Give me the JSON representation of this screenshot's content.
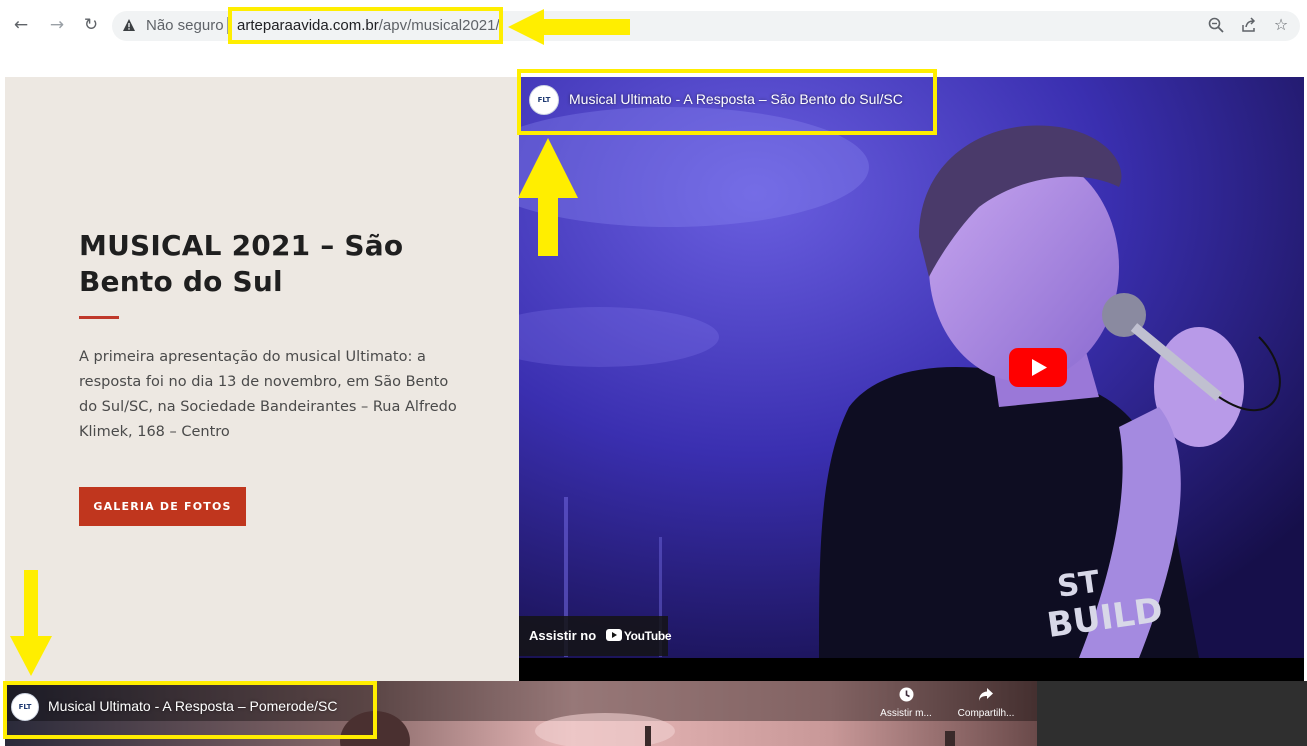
{
  "browser": {
    "not_secure_label": "Não seguro",
    "url_domain": "arteparaavida.com.br",
    "url_path": "/apv/musical2021/",
    "back_icon": "back-arrow-icon",
    "forward_icon": "forward-arrow-icon",
    "reload_icon": "reload-icon",
    "zoom_icon": "zoom-out-icon",
    "share_icon": "share-icon",
    "bookmark_icon": "star-icon"
  },
  "main": {
    "heading": "MUSICAL 2021 – São Bento do Sul",
    "description": "A primeira apresentação do musical Ultimato: a resposta foi no dia 13 de novembro, em São Bento do Sul/SC, na Sociedade Bandeirantes – Rua Alfredo Klimek, 168 – Centro",
    "gallery_button": "GALERIA DE FOTOS",
    "accent_color": "#c0361e"
  },
  "video1": {
    "title": "Musical Ultimato - A Resposta – São Bento do Sul/SC",
    "channel_logo_text": "FLT",
    "watch_on_label": "Assistir no",
    "watch_on_brand": "YouTube"
  },
  "video2": {
    "title": "Musical Ultimato - A Resposta – Pomerode/SC",
    "channel_logo_text": "FLT",
    "watch_later_label": "Assistir m...",
    "share_label": "Compartilh..."
  },
  "annotations": {
    "highlight_color": "#ffee00"
  }
}
